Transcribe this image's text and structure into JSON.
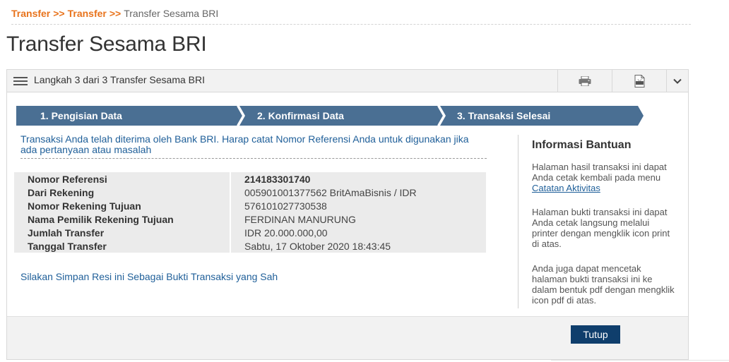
{
  "breadcrumb": {
    "items": [
      "Transfer",
      "Transfer"
    ],
    "separator": ">>",
    "current": "Transfer Sesama BRI"
  },
  "page_title": "Transfer Sesama BRI",
  "panel": {
    "title": "Langkah 3 dari 3 Transfer Sesama BRI",
    "icons": [
      "menu-icon",
      "print-icon",
      "pdf-icon",
      "chevron-down-icon"
    ]
  },
  "steps": [
    {
      "label": "1. Pengisian Data"
    },
    {
      "label": "2. Konfirmasi Data"
    },
    {
      "label": "3. Transaksi Selesai"
    }
  ],
  "success_message": "Transaksi Anda telah diterima oleh Bank BRI. Harap catat Nomor Referensi Anda untuk digunakan jika ada pertanyaan atau masalah",
  "details": [
    {
      "label": "Nomor Referensi",
      "value": "214183301740"
    },
    {
      "label": "Dari Rekening",
      "value": "005901001377562 BritAmaBisnis / IDR"
    },
    {
      "label": "Nomor Rekening Tujuan",
      "value": "576101027730538"
    },
    {
      "label": "Nama Pemilik Rekening Tujuan",
      "value": "FERDINAN MANURUNG"
    },
    {
      "label": "Jumlah Transfer",
      "value": "IDR 20.000.000,00"
    },
    {
      "label": "Tanggal Transfer",
      "value": "Sabtu, 17 Oktober 2020 18:43:45"
    }
  ],
  "save_message": "Silakan Simpan Resi ini Sebagai Bukti Transaksi yang Sah",
  "info": {
    "title": "Informasi Bantuan",
    "p1_text": "Halaman hasil transaksi ini dapat Anda cetak kembali pada menu ",
    "p1_link": "Catatan Aktivitas",
    "p2": "Halaman bukti transaksi ini dapat Anda cetak langsung melalui printer dengan mengklik icon print di atas.",
    "p3": "Anda juga dapat mencetak halaman bukti transaksi ini ke dalam bentuk pdf dengan mengklik icon pdf di atas."
  },
  "footer": {
    "close_label": "Tutup"
  },
  "colors": {
    "accent_orange": "#e8731c",
    "step_blue": "#4a6f93",
    "link_blue": "#1f5f99",
    "button_navy": "#0f3e6c"
  }
}
